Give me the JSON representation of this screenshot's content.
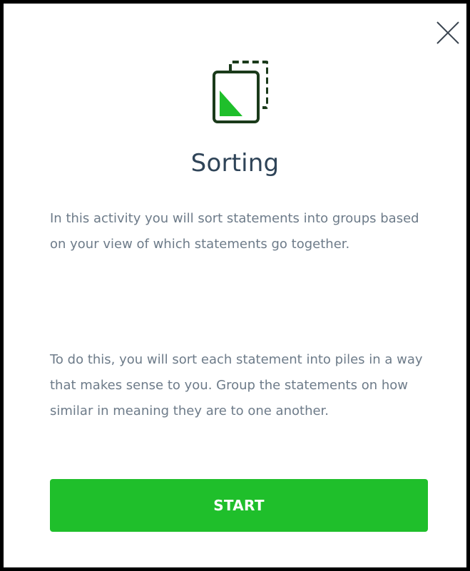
{
  "dialog": {
    "title": "Sorting",
    "paragraphs": [
      "In this activity you will sort statements into groups based on your view of which statements go together.",
      "To do this, you will sort each statement into piles in a way that makes sense to you. Group the statements on how similar in meaning they are to one another."
    ],
    "start_label": "START",
    "icons": {
      "close": "close-icon",
      "hero": "sorting-cards-icon"
    }
  },
  "colors": {
    "accent": "#1fbf2b",
    "icon_outline": "#1a3a1a",
    "title": "#2f4458",
    "body_text": "#6d7b89"
  }
}
